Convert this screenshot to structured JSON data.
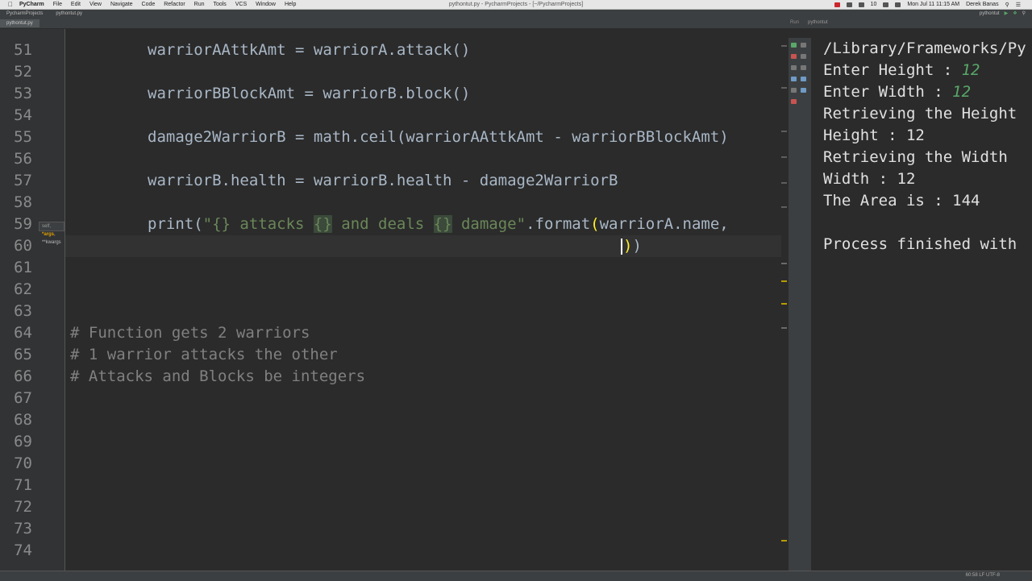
{
  "mac_menu": {
    "app": "PyCharm",
    "items": [
      "File",
      "Edit",
      "View",
      "Navigate",
      "Code",
      "Refactor",
      "Run",
      "Tools",
      "VCS",
      "Window",
      "Help"
    ],
    "window_title": "pythontut.py - PycharmProjects - [~/PycharmProjects]",
    "tray_text": "10",
    "clock": "Mon Jul 11  11:15 AM",
    "user": "Derek Banas"
  },
  "toolbar": {
    "breadcrumbs": [
      "PycharmProjects",
      "pythontut.py"
    ],
    "open_tab": "pythontut.py",
    "run_config": "pythontut",
    "run_panel_label": "Run",
    "run_panel_config": "pythontut"
  },
  "editor": {
    "line_numbers": [
      "51",
      "52",
      "53",
      "54",
      "55",
      "56",
      "57",
      "58",
      "59",
      "60",
      "61",
      "62",
      "63",
      "64",
      "65",
      "66",
      "67",
      "68",
      "69",
      "70",
      "71",
      "72",
      "73",
      "74"
    ],
    "lines": {
      "l51": "warriorAAttkAmt = warriorA.attack()",
      "l53": "warriorBBlockAmt = warriorB.block()",
      "l55": "damage2WarriorB = math.ceil(warriorAAttkAmt - warriorBBlockAmt)",
      "l57": "warriorB.health = warriorB.health - damage2WarriorB",
      "l59_pre": "print(",
      "l59_s1": "\"{} attacks ",
      "l59_b1": "{}",
      "l59_s2": " and deals ",
      "l59_b2": "{}",
      "l59_s3": " damage\"",
      "l59_mid": ".format",
      "l59_paren": "(",
      "l59_post": "warriorA.name,",
      "l60_paren": ")",
      "l60_post": ")",
      "l64": "# Function gets 2 warriors",
      "l65": "# 1 warrior attacks the other",
      "l66": "# Attacks and Blocks be integers"
    },
    "param_hint": {
      "self": "self, ",
      "args": "*args",
      "kwargs": ", **kwargs"
    }
  },
  "console": {
    "path": "/Library/Frameworks/Py",
    "lines": [
      {
        "label": "Enter Height : ",
        "input": "12"
      },
      {
        "label": "Enter Width : ",
        "input": "12"
      },
      {
        "label": "Retrieving the Height"
      },
      {
        "label": "Height : 12"
      },
      {
        "label": "Retrieving the Width"
      },
      {
        "label": "Width : 12"
      },
      {
        "label": "The Area is : 144"
      },
      {
        "label": ""
      },
      {
        "label": "Process finished with"
      }
    ]
  },
  "statusbar": {
    "position": "60:58  LF  UTF-8"
  },
  "colors": {
    "background": "#2b2b2b",
    "code_text": "#a9b7c6",
    "string": "#6a8759",
    "comment": "#808080",
    "input_text": "#59a869"
  }
}
